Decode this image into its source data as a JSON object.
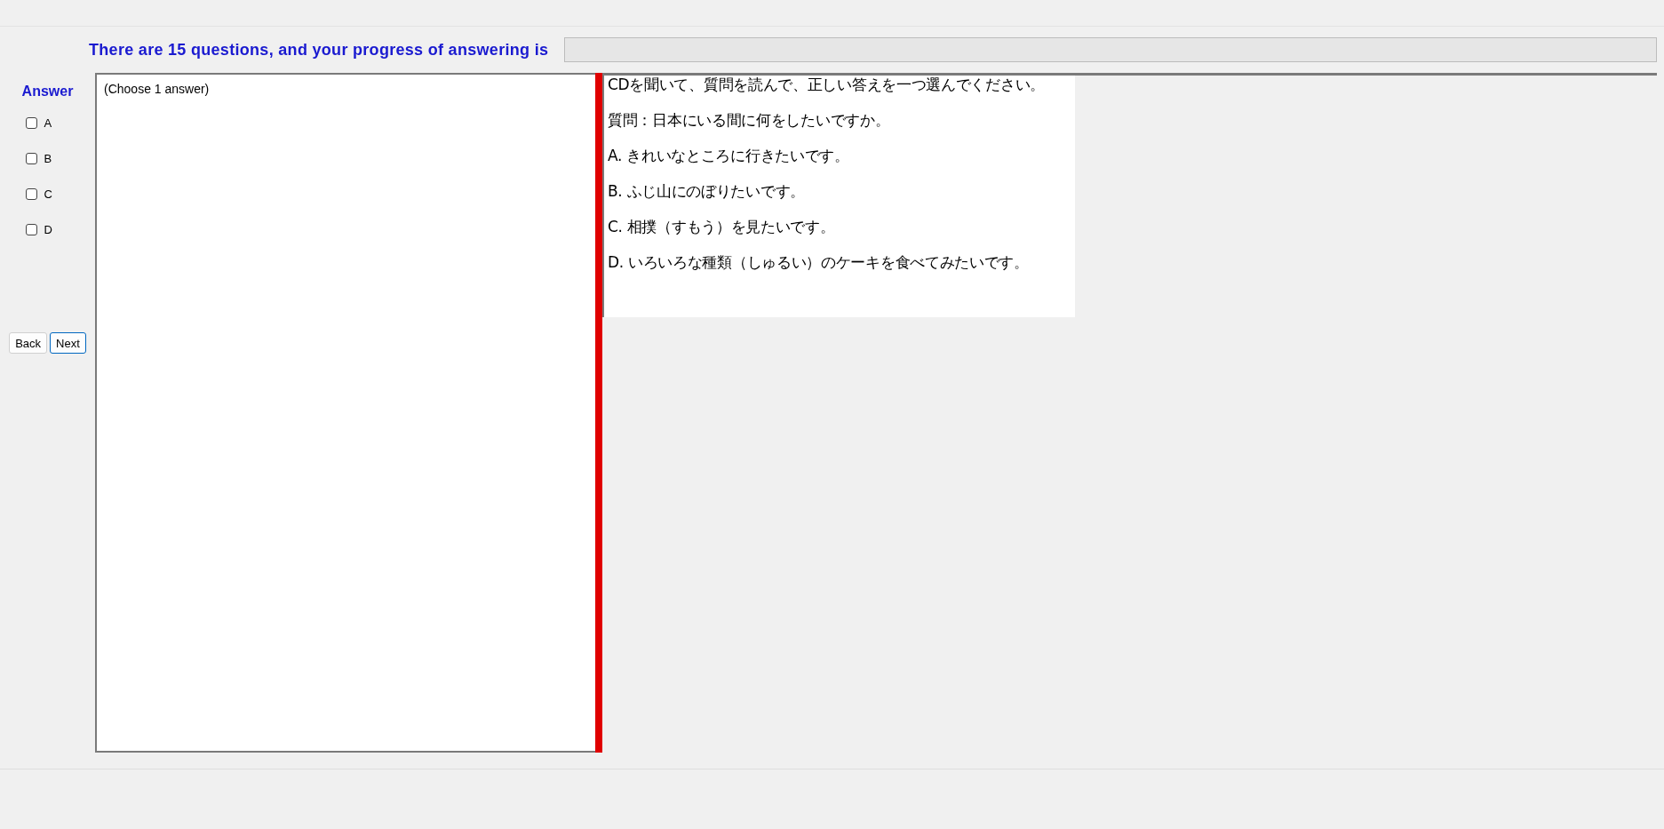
{
  "progress": {
    "label": "There are 15 questions, and your progress of answering is",
    "level": 0
  },
  "answer": {
    "title": "Answer",
    "options": [
      {
        "label": "A",
        "checked": false
      },
      {
        "label": "B",
        "checked": false
      },
      {
        "label": "C",
        "checked": false
      },
      {
        "label": "D",
        "checked": false
      }
    ]
  },
  "buttons": [
    {
      "label": "Back",
      "focused": false
    },
    {
      "label": "Next",
      "focused": true
    }
  ],
  "answer_note": "(Choose 1 answer)",
  "question": {
    "lines": [
      "CDを聞いて、質問を読んで、正しい答えを一つ選んでください。",
      "質問：日本にいる間に何をしたいですか。",
      "A.  きれいなところに行きたいです。",
      "B.  ふじ山にのぼりたいです。",
      "C.  相撲（すもう）を見たいです。",
      "D.  いろいろな種類（しゅるい）のケーキを食べてみたいです。"
    ]
  }
}
